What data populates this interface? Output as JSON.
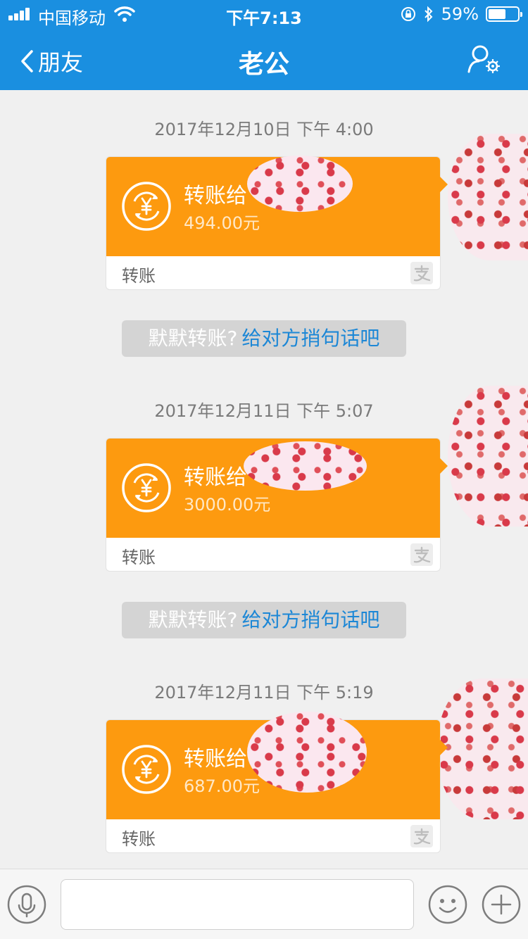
{
  "status_bar": {
    "carrier": "中国移动",
    "time": "下午7:13",
    "battery_percent": "59%",
    "battery_level": 0.59
  },
  "nav": {
    "back_label": "朋友",
    "title": "老公"
  },
  "messages": [
    {
      "timestamp": "2017年12月10日 下午 4:00",
      "title": "转账给",
      "amount": "494.00元",
      "label": "转账"
    },
    {
      "timestamp": "2017年12月11日 下午 5:07",
      "title": "转账给",
      "amount": "3000.00元",
      "label": "转账"
    },
    {
      "timestamp": "2017年12月11日 下午 5:19",
      "title": "转账给",
      "amount": "687.00元",
      "label": "转账"
    }
  ],
  "hints": [
    {
      "muted": "默默转账?",
      "link": "给对方捎句话吧"
    },
    {
      "muted": "默默转账?",
      "link": "给对方捎句话吧"
    }
  ],
  "input": {
    "value": ""
  },
  "colors": {
    "header": "#1a8fe0",
    "transfer_card": "#fd9a0f",
    "link": "#1c87d6"
  }
}
